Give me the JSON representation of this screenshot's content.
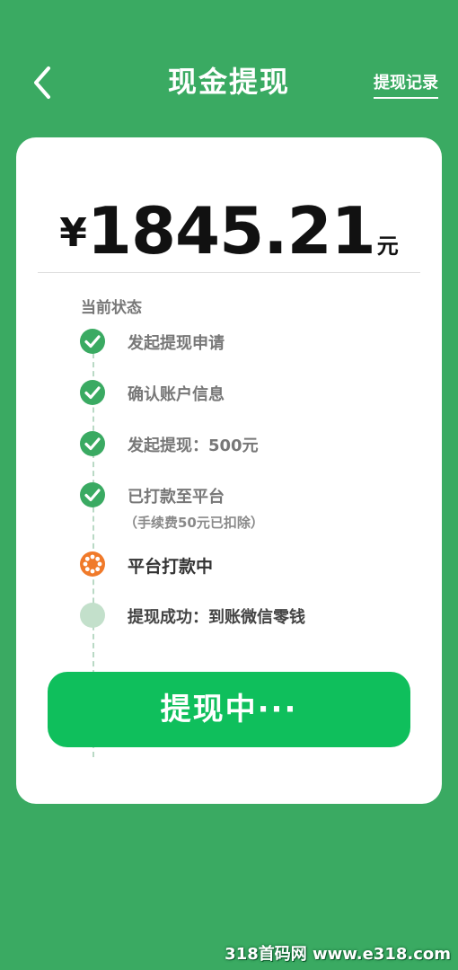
{
  "header": {
    "title": "现金提现",
    "records_link": "提现记录"
  },
  "amount": {
    "currency": "¥",
    "value": "1845.21",
    "unit": "元"
  },
  "status": {
    "label": "当前状态",
    "steps": [
      {
        "label": "发起提现申请",
        "state": "done"
      },
      {
        "label": "确认账户信息",
        "state": "done"
      },
      {
        "label": "发起提现：500元",
        "state": "done"
      },
      {
        "label": "已打款至平台",
        "sub": "（手续费50元已扣除）",
        "state": "done"
      },
      {
        "label": "平台打款中",
        "state": "active"
      },
      {
        "label": "提现成功：到账微信零钱",
        "state": "pending"
      }
    ]
  },
  "button": {
    "label": "提现中···"
  },
  "watermark": "318首码网 www.e318.com",
  "colors": {
    "background": "#3aaa62",
    "done": "#3aaa62",
    "active": "#f07a2a",
    "pending": "#c3e0cb",
    "button": "#0fbf5c"
  }
}
